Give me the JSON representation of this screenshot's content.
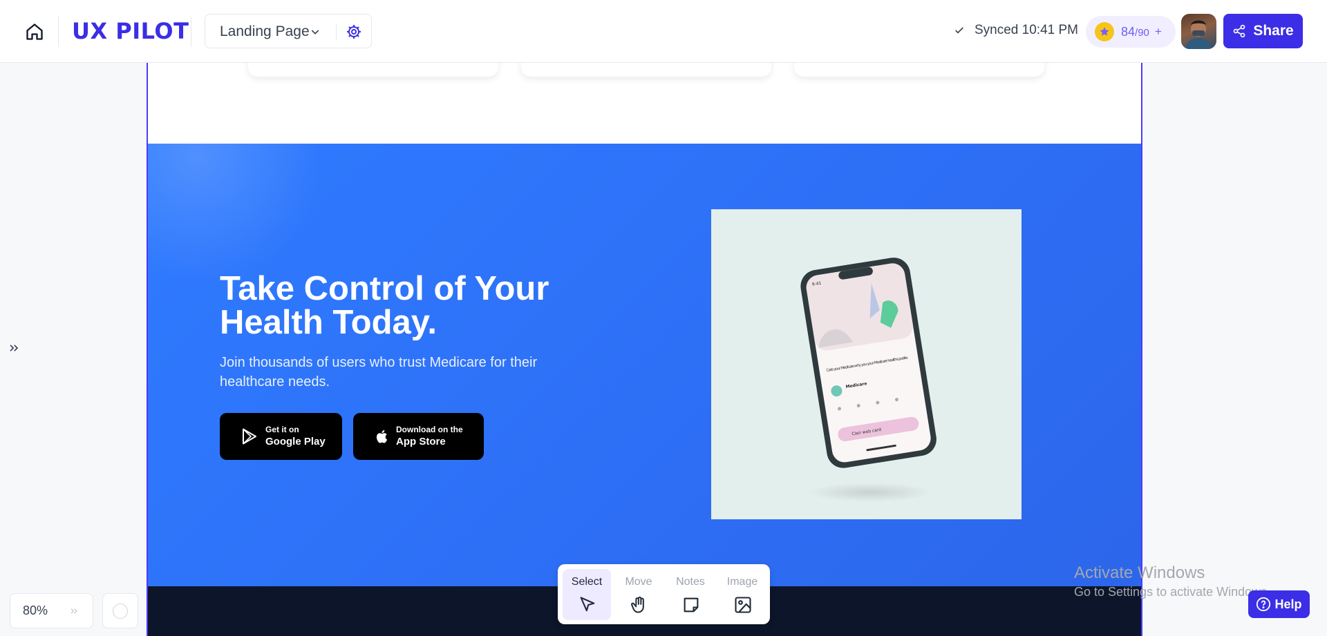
{
  "app": {
    "logo": "UX PILOT"
  },
  "header": {
    "page_selector": "Landing Page",
    "sync_status": "Synced 10:41 PM",
    "credits": {
      "used": "84",
      "total": "/90",
      "add": "+"
    },
    "share_label": "Share"
  },
  "landing": {
    "headline": "Take Control of Your Health Today.",
    "subtext": "Join thousands of users who trust Medicare for their healthcare needs.",
    "google_play": {
      "small": "Get it on",
      "big": "Google Play"
    },
    "app_store": {
      "small": "Download on the",
      "big": "App Store"
    },
    "phone_screen_text": "Carb your Medicare why you your Medicare healths positiv.",
    "phone_screen_name": "Medicare",
    "phone_screen_button": "Clair web card"
  },
  "canvas": {
    "zoom": "80%"
  },
  "tools": [
    {
      "label": "Select",
      "icon": "cursor-icon",
      "active": true
    },
    {
      "label": "Move",
      "icon": "hand-icon",
      "active": false
    },
    {
      "label": "Notes",
      "icon": "note-icon",
      "active": false
    },
    {
      "label": "Image",
      "icon": "image-icon",
      "active": false
    }
  ],
  "watermark": {
    "line1": "Activate Windows",
    "line2": "Go to Settings to activate Windows."
  },
  "help_label": "Help",
  "colors": {
    "brand": "#3b2ee6",
    "hero_blue": "#2f7bff",
    "footer_dark": "#0c1529"
  }
}
